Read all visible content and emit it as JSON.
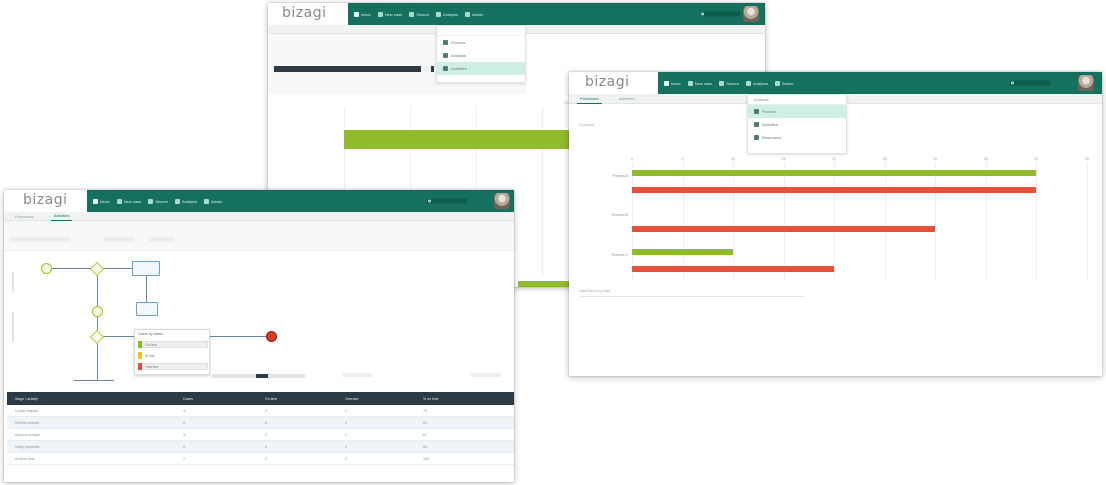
{
  "colors": {
    "brand_nav": "#15705e",
    "on_time_bar": "#8fbb2d",
    "overdue_bar": "#e6503a",
    "table_header": "#2b3a44"
  },
  "logo": "bizagi",
  "nav": {
    "items": [
      {
        "label": "Inbox",
        "icon": "inbox-icon"
      },
      {
        "label": "New case",
        "icon": "new-case-icon"
      },
      {
        "label": "Search",
        "icon": "search-icon"
      },
      {
        "label": "Analysis",
        "icon": "analysis-icon"
      },
      {
        "label": "Admin",
        "icon": "admin-icon"
      }
    ]
  },
  "windows": {
    "back": {
      "menu_items": [
        "Analysis",
        "Process",
        "Activities"
      ],
      "menu_highlight_index": 2,
      "chart_legend": "On time  Overdue"
    },
    "right": {
      "tabs": [
        "Processes",
        "Activities"
      ],
      "menu_title": "Analysis",
      "menu_items": [
        "Process",
        "Activities",
        "Resources"
      ],
      "menu_highlight_index": 0,
      "summary_line": "3 process",
      "footnote": "Data filtered by date"
    },
    "left": {
      "tabs": [
        "Processes",
        "Activities"
      ],
      "popup_title": "Cases by status",
      "popup_rows": [
        "On time",
        "At risk",
        "Overdue"
      ],
      "table_headers": [
        "Stage / activity",
        "Cases",
        "On time",
        "Overdue",
        "% on time"
      ],
      "table_rows": [
        [
          "Create request",
          "4",
          "3",
          "1",
          "75"
        ],
        [
          "Review request",
          "6",
          "5",
          "1",
          "83"
        ],
        [
          "Approve budget",
          "3",
          "2",
          "1",
          "67"
        ],
        [
          "Notify requester",
          "5",
          "4",
          "1",
          "80"
        ],
        [
          "Archive case",
          "2",
          "2",
          "0",
          "100"
        ]
      ]
    }
  },
  "chart_data": {
    "type": "bar",
    "orientation": "horizontal",
    "categories": [
      "Process A",
      "Process B",
      "Process C"
    ],
    "series": [
      {
        "name": "On time",
        "color": "#8fbb2d",
        "values": [
          40,
          0,
          10
        ]
      },
      {
        "name": "Overdue",
        "color": "#e6503a",
        "values": [
          40,
          30,
          20
        ]
      }
    ],
    "xlim": [
      0,
      45
    ],
    "x_ticks": [
      0,
      5,
      10,
      15,
      20,
      25,
      30,
      35,
      40,
      45
    ],
    "grid": true,
    "legend": "top"
  }
}
